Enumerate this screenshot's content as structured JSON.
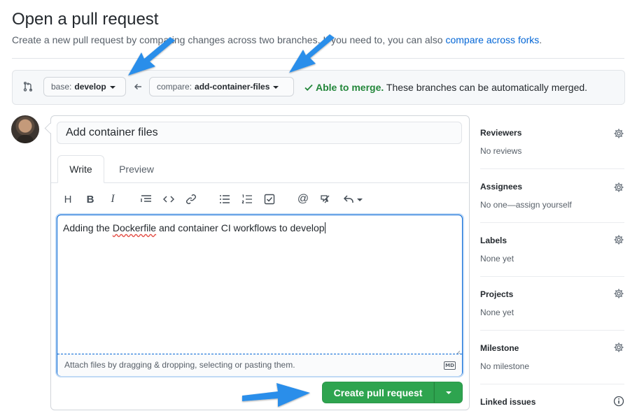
{
  "page": {
    "title": "Open a pull request",
    "subtitle_text": "Create a new pull request by comparing changes across two branches. If you need to, you can also",
    "subtitle_link": "compare across forks",
    "subtitle_end": "."
  },
  "range": {
    "base_label": "base:",
    "base_branch": "develop",
    "compare_label": "compare:",
    "compare_branch": "add-container-files",
    "merge_status": "Able to merge.",
    "merge_detail": "These branches can be automatically merged."
  },
  "editor": {
    "title_value": "Add container files",
    "tabs": {
      "write": "Write",
      "preview": "Preview"
    },
    "body_pre": "Adding the ",
    "body_misspelled": "Dockerfile",
    "body_post": " and container CI workflows to develop",
    "attach_text": "Attach files by dragging & dropping, selecting or pasting them.",
    "markdown_badge": "MD",
    "submit_label": "Create pull request"
  },
  "toolbar_icons": [
    "heading-icon",
    "bold-icon",
    "italic-icon",
    "quote-icon",
    "code-icon",
    "link-icon",
    "unordered-list-icon",
    "ordered-list-icon",
    "task-list-icon",
    "mention-icon",
    "reference-icon",
    "reply-icon"
  ],
  "sidebar": {
    "reviewers": {
      "title": "Reviewers",
      "value": "No reviews"
    },
    "assignees": {
      "title": "Assignees",
      "value": "No one—assign yourself"
    },
    "labels": {
      "title": "Labels",
      "value": "None yet"
    },
    "projects": {
      "title": "Projects",
      "value": "None yet"
    },
    "milestone": {
      "title": "Milestone",
      "value": "No milestone"
    },
    "linked_issues": {
      "title": "Linked issues"
    }
  },
  "colors": {
    "primary_button": "#2ea44f",
    "link": "#0366d6",
    "success_text": "#22863a",
    "annotation_arrow": "#2b8eea"
  }
}
